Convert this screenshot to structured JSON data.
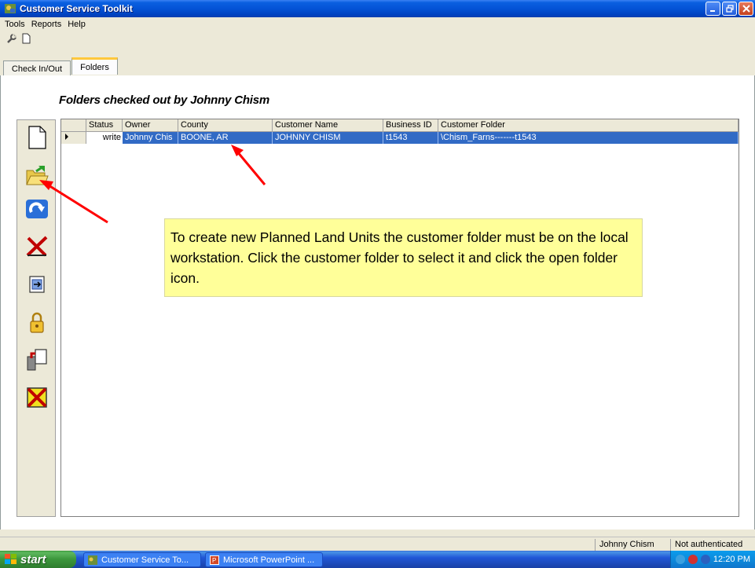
{
  "window": {
    "title": "Customer Service Toolkit"
  },
  "menu": {
    "items": [
      "Tools",
      "Reports",
      "Help"
    ]
  },
  "tabs": [
    {
      "label": "Check In/Out"
    },
    {
      "label": "Folders"
    }
  ],
  "panel": {
    "title": "Folders checked out by Johnny Chism"
  },
  "grid": {
    "columns": [
      "Status",
      "Owner",
      "County",
      "Customer Name",
      "Business ID",
      "Customer Folder"
    ],
    "rows": [
      {
        "status": "write",
        "owner": "Johnny Chis",
        "county": "BOONE, AR",
        "customer_name": "JOHNNY CHISM",
        "business_id": "t1543",
        "customer_folder": "\\Chism_Farns-------t1543"
      }
    ]
  },
  "callout": {
    "text": "To create new Planned Land Units the customer folder must be on the local workstation. Click the customer folder to select it and click the open folder icon."
  },
  "statusbar": {
    "user": "Johnny Chism",
    "auth": "Not authenticated"
  },
  "taskbar": {
    "start_label": "start",
    "tasks": [
      "Customer Service To...",
      "Microsoft PowerPoint ..."
    ],
    "clock": "12:20 PM"
  },
  "colors": {
    "selection": "#316ac5",
    "callout": "#ffff99",
    "arrow": "#ff0000"
  }
}
